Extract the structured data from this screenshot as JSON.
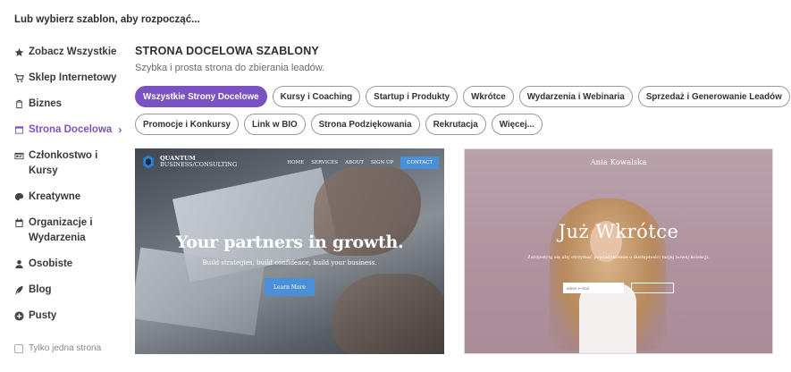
{
  "heading": "Lub wybierz szablon, aby rozpocząć...",
  "sidebar": {
    "items": [
      {
        "label": "Zobacz Wszystkie",
        "icon": "star-icon"
      },
      {
        "label": "Sklep Internetowy",
        "icon": "cart-icon"
      },
      {
        "label": "Biznes",
        "icon": "clipboard-icon"
      },
      {
        "label": "Strona Docelowa",
        "icon": "window-icon",
        "active": true
      },
      {
        "label": "Członkostwo i Kursy",
        "icon": "id-card-icon"
      },
      {
        "label": "Kreatywne",
        "icon": "palette-icon"
      },
      {
        "label": "Organizacje i Wydarzenia",
        "icon": "calendar-icon"
      },
      {
        "label": "Osobiste",
        "icon": "user-icon"
      },
      {
        "label": "Blog",
        "icon": "quill-icon"
      },
      {
        "label": "Pusty",
        "icon": "plus-circle-icon"
      }
    ],
    "active_chevron": "›",
    "checkbox_label": "Tylko jedna strona"
  },
  "main": {
    "title": "STRONA DOCELOWA SZABLONY",
    "subtitle": "Szybka i prosta strona do zbierania leadów."
  },
  "filters": {
    "row1": [
      "Wszystkie Strony Docelowe",
      "Kursy i Coaching",
      "Startup i Produkty",
      "Wkrótce",
      "Wydarzenia i Webinaria",
      "Sprzedaż i Generowanie Leadów"
    ],
    "row2": [
      "Promocje i Konkursy",
      "Link w BIO",
      "Strona Podziękowania",
      "Rekrutacja",
      "Więcej..."
    ],
    "active": "Wszystkie Strony Docelowe"
  },
  "cards": [
    {
      "logo_line1": "QUANTUM",
      "logo_line2": "BUSINESS/CONSULTING",
      "nav": [
        "HOME",
        "SERVICES",
        "ABOUT",
        "SIGN UP"
      ],
      "nav_cta": "CONTACT",
      "headline": "Your partners in growth.",
      "subheadline": "Build strategies, build confidence, build your business.",
      "button": "Learn More"
    },
    {
      "name": "Ania Kowalska",
      "headline": "Już Wkrótce",
      "subheadline": "Zarejestruj się aby otrzymać powiadomienie o dostępności mojej nowej kolekcji.",
      "input_placeholder": "adres e-mail"
    }
  ],
  "colors": {
    "accent": "#7b52c1",
    "cta_blue": "#4a90d9"
  }
}
